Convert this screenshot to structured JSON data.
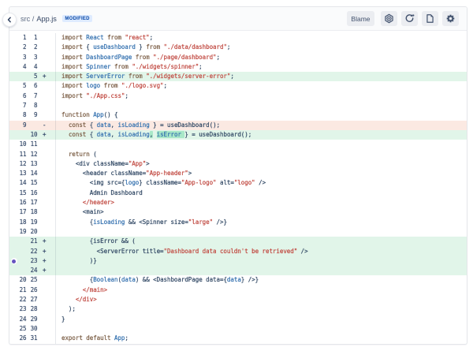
{
  "colors": {
    "card_border": "#E4E6EA",
    "header_bg": "#FAFBFC",
    "header_border": "#ECEDF0",
    "path_color": "#5E6C84",
    "file_color": "#344563",
    "badge_bg": "#DEEBFF",
    "badge_text": "#0747A6",
    "btn_bg": "#EBEDF1",
    "icon_color": "#42526E",
    "linenum_color": "#3B4F6E",
    "gutter_sep": "rgba(9,30,66,0.10)",
    "code_default": "#334A66",
    "code_keyword": "#7D6048",
    "code_ident": "#3572B0",
    "code_string": "#C14A42",
    "add_bg": "#E1F5E9",
    "add_word_bg": "#A9E8C8",
    "del_bg": "#FBE9E2",
    "comment_dot": "#6554C0"
  },
  "header": {
    "back_icon": "chevron-left",
    "breadcrumb": {
      "path": "src /",
      "file": "App.js"
    },
    "status_badge": "MODIFIED",
    "blame_label": "Blame",
    "icon_buttons": [
      {
        "name": "view-settings-nut-icon"
      },
      {
        "name": "refresh-icon"
      },
      {
        "name": "raw-file-icon"
      },
      {
        "name": "settings-gear-icon"
      }
    ]
  },
  "diff": {
    "rows": [
      {
        "old": "1",
        "new": "1",
        "sign": "",
        "type": "ctx",
        "segments": [
          [
            "import ",
            "kw"
          ],
          [
            "React",
            "id"
          ],
          [
            " ",
            "df"
          ],
          [
            "from ",
            "kw"
          ],
          [
            "\"react\"",
            "str"
          ],
          [
            ";",
            "df"
          ]
        ]
      },
      {
        "old": "2",
        "new": "2",
        "sign": "",
        "type": "ctx",
        "segments": [
          [
            "import ",
            "kw"
          ],
          [
            "{ ",
            "df"
          ],
          [
            "useDashboard",
            "id"
          ],
          [
            " } ",
            "df"
          ],
          [
            "from ",
            "kw"
          ],
          [
            "\"./data/dashboard\"",
            "str"
          ],
          [
            ";",
            "df"
          ]
        ]
      },
      {
        "old": "3",
        "new": "3",
        "sign": "",
        "type": "ctx",
        "segments": [
          [
            "import ",
            "kw"
          ],
          [
            "DashboardPage",
            "id"
          ],
          [
            " ",
            "df"
          ],
          [
            "from ",
            "kw"
          ],
          [
            "\"./page/dashboard\"",
            "str"
          ],
          [
            ";",
            "df"
          ]
        ]
      },
      {
        "old": "4",
        "new": "4",
        "sign": "",
        "type": "ctx",
        "segments": [
          [
            "import ",
            "kw"
          ],
          [
            "Spinner",
            "id"
          ],
          [
            " ",
            "df"
          ],
          [
            "from ",
            "kw"
          ],
          [
            "\"./widgets/spinner\"",
            "str"
          ],
          [
            ";",
            "df"
          ]
        ]
      },
      {
        "old": "",
        "new": "5",
        "sign": "+",
        "type": "add",
        "segments": [
          [
            "import ",
            "kw"
          ],
          [
            "ServerError",
            "id"
          ],
          [
            " ",
            "df"
          ],
          [
            "from ",
            "kw"
          ],
          [
            "\"./widgets/server-error\"",
            "str"
          ],
          [
            ";",
            "df"
          ]
        ]
      },
      {
        "old": "5",
        "new": "6",
        "sign": "",
        "type": "ctx",
        "segments": [
          [
            "import ",
            "kw"
          ],
          [
            "logo",
            "id"
          ],
          [
            " ",
            "df"
          ],
          [
            "from ",
            "kw"
          ],
          [
            "\"./logo.svg\"",
            "str"
          ],
          [
            ";",
            "df"
          ]
        ]
      },
      {
        "old": "6",
        "new": "7",
        "sign": "",
        "type": "ctx",
        "segments": [
          [
            "import ",
            "kw"
          ],
          [
            "\"./App.css\"",
            "str"
          ],
          [
            ";",
            "df"
          ]
        ]
      },
      {
        "old": "7",
        "new": "8",
        "sign": "",
        "type": "ctx",
        "segments": []
      },
      {
        "old": "8",
        "new": "9",
        "sign": "",
        "type": "ctx",
        "segments": [
          [
            "function ",
            "kw"
          ],
          [
            "App",
            "id"
          ],
          [
            "() {",
            "df"
          ]
        ]
      },
      {
        "old": "9",
        "new": "",
        "sign": "-",
        "type": "del",
        "segments": [
          [
            "  ",
            "df"
          ],
          [
            "const ",
            "kw"
          ],
          [
            "{ ",
            "df"
          ],
          [
            "data",
            "id"
          ],
          [
            ", ",
            "df"
          ],
          [
            "isLoading",
            "id"
          ],
          [
            " } = useDashboard();",
            "df"
          ]
        ]
      },
      {
        "old": "",
        "new": "10",
        "sign": "+",
        "type": "add",
        "segments": [
          [
            "  ",
            "df"
          ],
          [
            "const ",
            "kw"
          ],
          [
            "{ ",
            "df"
          ],
          [
            "data",
            "id"
          ],
          [
            ", ",
            "df"
          ],
          [
            "isLoading",
            "id"
          ],
          [
            ",",
            "df",
            "m"
          ],
          [
            " ",
            "df"
          ],
          [
            "isError ",
            "id",
            "m"
          ],
          [
            "} = useDashboard();",
            "df"
          ]
        ]
      },
      {
        "old": "10",
        "new": "11",
        "sign": "",
        "type": "ctx",
        "segments": []
      },
      {
        "old": "11",
        "new": "12",
        "sign": "",
        "type": "ctx",
        "segments": [
          [
            "  ",
            "df"
          ],
          [
            "return ",
            "kw"
          ],
          [
            "(",
            "df"
          ]
        ]
      },
      {
        "old": "12",
        "new": "13",
        "sign": "",
        "type": "ctx",
        "segments": [
          [
            "    <div className=",
            "df"
          ],
          [
            "\"App\"",
            "str"
          ],
          [
            ">",
            "df"
          ]
        ]
      },
      {
        "old": "13",
        "new": "14",
        "sign": "",
        "type": "ctx",
        "segments": [
          [
            "      <header className=",
            "df"
          ],
          [
            "\"App-header\"",
            "str"
          ],
          [
            ">",
            "df"
          ]
        ]
      },
      {
        "old": "14",
        "new": "15",
        "sign": "",
        "type": "ctx",
        "segments": [
          [
            "        <img src={",
            "df"
          ],
          [
            "logo",
            "id"
          ],
          [
            "} className=",
            "df"
          ],
          [
            "\"App-logo\"",
            "str"
          ],
          [
            " alt=",
            "df"
          ],
          [
            "\"logo\"",
            "str"
          ],
          [
            " />",
            "df"
          ]
        ]
      },
      {
        "old": "15",
        "new": "16",
        "sign": "",
        "type": "ctx",
        "segments": [
          [
            "        Admin Dashboard",
            "df"
          ]
        ]
      },
      {
        "old": "16",
        "new": "17",
        "sign": "",
        "type": "ctx",
        "segments": [
          [
            "      ",
            "df"
          ],
          [
            "</header>",
            "str"
          ]
        ]
      },
      {
        "old": "17",
        "new": "18",
        "sign": "",
        "type": "ctx",
        "segments": [
          [
            "      <main>",
            "df"
          ]
        ]
      },
      {
        "old": "18",
        "new": "19",
        "sign": "",
        "type": "ctx",
        "segments": [
          [
            "        {",
            "df"
          ],
          [
            "isLoading",
            "id"
          ],
          [
            " && <Spinner size=",
            "df"
          ],
          [
            "\"large\"",
            "str"
          ],
          [
            " />}",
            "df"
          ]
        ]
      },
      {
        "old": "19",
        "new": "20",
        "sign": "",
        "type": "ctx",
        "segments": []
      },
      {
        "old": "",
        "new": "21",
        "sign": "+",
        "type": "add",
        "segments": [
          [
            "        {isError && (",
            "df"
          ]
        ]
      },
      {
        "old": "",
        "new": "22",
        "sign": "+",
        "type": "add",
        "segments": [
          [
            "          <ServerError title=",
            "df"
          ],
          [
            "\"Dashboard data couldn't be retrieved\"",
            "str"
          ],
          [
            " />",
            "df"
          ]
        ]
      },
      {
        "old": "",
        "new": "23",
        "sign": "+",
        "type": "add",
        "segments": [
          [
            "        )}",
            "df"
          ]
        ],
        "comment_dot": true
      },
      {
        "old": "",
        "new": "24",
        "sign": "+",
        "type": "add",
        "segments": []
      },
      {
        "old": "20",
        "new": "25",
        "sign": "",
        "type": "ctx",
        "segments": [
          [
            "        {",
            "df"
          ],
          [
            "Boolean",
            "id"
          ],
          [
            "(",
            "df"
          ],
          [
            "data",
            "id"
          ],
          [
            ") && <DashboardPage data={",
            "df"
          ],
          [
            "data",
            "id"
          ],
          [
            "} />}",
            "df"
          ]
        ]
      },
      {
        "old": "21",
        "new": "26",
        "sign": "",
        "type": "ctx",
        "segments": [
          [
            "      ",
            "df"
          ],
          [
            "</main>",
            "str"
          ]
        ]
      },
      {
        "old": "22",
        "new": "27",
        "sign": "",
        "type": "ctx",
        "segments": [
          [
            "    ",
            "df"
          ],
          [
            "</div>",
            "str"
          ]
        ]
      },
      {
        "old": "23",
        "new": "28",
        "sign": "",
        "type": "ctx",
        "segments": [
          [
            "  );",
            "df"
          ]
        ]
      },
      {
        "old": "24",
        "new": "29",
        "sign": "",
        "type": "ctx",
        "segments": [
          [
            "}",
            "df"
          ]
        ]
      },
      {
        "old": "25",
        "new": "30",
        "sign": "",
        "type": "ctx",
        "segments": []
      },
      {
        "old": "26",
        "new": "31",
        "sign": "",
        "type": "ctx",
        "segments": [
          [
            "export default ",
            "kw"
          ],
          [
            "App",
            "id"
          ],
          [
            ";",
            "df"
          ]
        ]
      }
    ]
  }
}
